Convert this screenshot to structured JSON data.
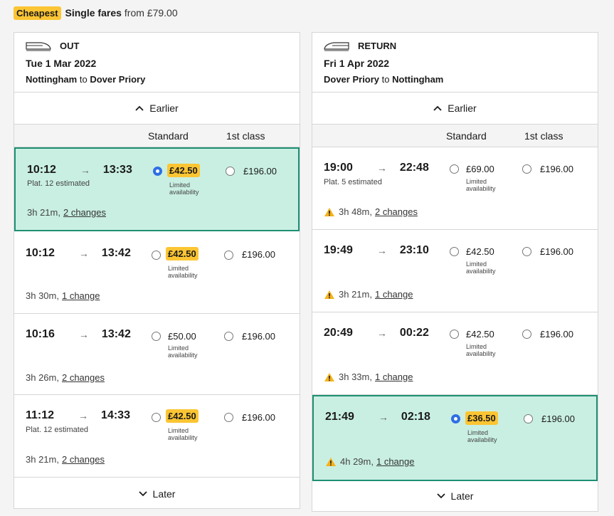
{
  "banner": {
    "badge": "Cheapest",
    "title": "Single fares",
    "from": "from £79.00"
  },
  "out": {
    "direction": "OUT",
    "date": "Tue 1 Mar 2022",
    "origin": "Nottingham",
    "to": "to",
    "destination": "Dover Priory",
    "earlier": "Earlier",
    "later": "Later",
    "col_standard": "Standard",
    "col_first": "1st class",
    "journeys": [
      {
        "dep": "10:12",
        "arr": "13:33",
        "platform": "Plat. 12 estimated",
        "duration": "3h 21m,",
        "changes": "2 changes",
        "std_price": "£42.50",
        "std_note_1": "Limited",
        "std_note_2": "availability",
        "first_price": "£196.00",
        "selected": true
      },
      {
        "dep": "10:12",
        "arr": "13:42",
        "platform": "",
        "duration": "3h 30m,",
        "changes": "1 change",
        "std_price": "£42.50",
        "std_note_1": "Limited",
        "std_note_2": "availability",
        "first_price": "£196.00"
      },
      {
        "dep": "10:16",
        "arr": "13:42",
        "platform": "",
        "duration": "3h 26m,",
        "changes": "2 changes",
        "std_price": "£50.00",
        "std_note_1": "Limited",
        "std_note_2": "availability",
        "first_price": "£196.00"
      },
      {
        "dep": "11:12",
        "arr": "14:33",
        "platform": "Plat. 12 estimated",
        "duration": "3h 21m,",
        "changes": "2 changes",
        "std_price": "£42.50",
        "std_note_1": "Limited",
        "std_note_2": "availability",
        "first_price": "£196.00"
      }
    ]
  },
  "ret": {
    "direction": "RETURN",
    "date": "Fri 1 Apr 2022",
    "origin": "Dover Priory",
    "to": "to",
    "destination": "Nottingham",
    "earlier": "Earlier",
    "later": "Later",
    "col_standard": "Standard",
    "col_first": "1st class",
    "journeys": [
      {
        "dep": "19:00",
        "arr": "22:48",
        "platform": "Plat. 5 estimated",
        "duration": "3h 48m,",
        "changes": "2 changes",
        "std_price": "£69.00",
        "std_note_1": "Limited",
        "std_note_2": "availability",
        "first_price": "£196.00",
        "warning": true
      },
      {
        "dep": "19:49",
        "arr": "23:10",
        "platform": "",
        "duration": "3h 21m,",
        "changes": "1 change",
        "std_price": "£42.50",
        "std_note_1": "Limited",
        "std_note_2": "availability",
        "first_price": "£196.00",
        "warning": true
      },
      {
        "dep": "20:49",
        "arr": "00:22",
        "platform": "",
        "duration": "3h 33m,",
        "changes": "1 change",
        "std_price": "£42.50",
        "std_note_1": "Limited",
        "std_note_2": "availability",
        "first_price": "£196.00",
        "warning": true
      },
      {
        "dep": "21:49",
        "arr": "02:18",
        "platform": "",
        "duration": "4h 29m,",
        "changes": "1 change",
        "std_price": "£36.50",
        "std_note_1": "Limited",
        "std_note_2": "availability",
        "first_price": "£196.00",
        "warning": true,
        "selected": true
      }
    ]
  },
  "colors": {
    "accent_yellow": "#fcc533",
    "selected_bg": "#c9efe3",
    "selected_border": "#1e8f72",
    "radio_blue": "#2f6fe4",
    "warning": "#f5b21b"
  },
  "icons": {
    "out": "train-icon",
    "return": "train-icon",
    "earlier": "chevron-up-icon",
    "later": "chevron-down-icon",
    "warning": "warning-icon"
  }
}
